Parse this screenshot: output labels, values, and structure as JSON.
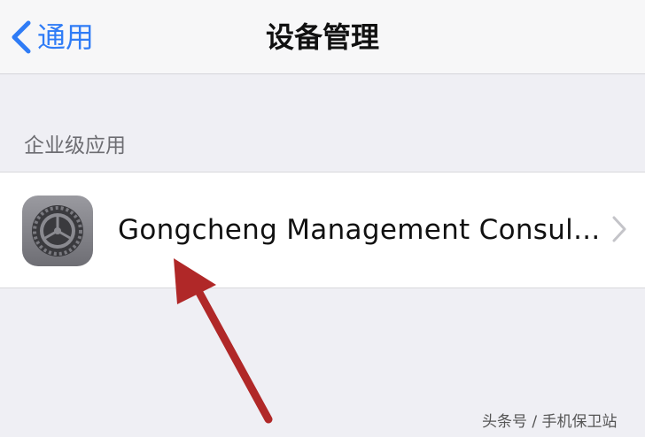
{
  "nav": {
    "back_label": "通用",
    "title": "设备管理"
  },
  "section": {
    "header": "企业级应用"
  },
  "profile": {
    "name": "Gongcheng Management Consul..."
  },
  "watermark": "头条号 / 手机保卫站",
  "icons": {
    "back": "chevron-left-icon",
    "app": "settings-gear-icon",
    "disclosure": "chevron-right-icon"
  },
  "colors": {
    "accent": "#2f7cf6",
    "annotation_arrow": "#b02828",
    "background": "#efeff4"
  }
}
